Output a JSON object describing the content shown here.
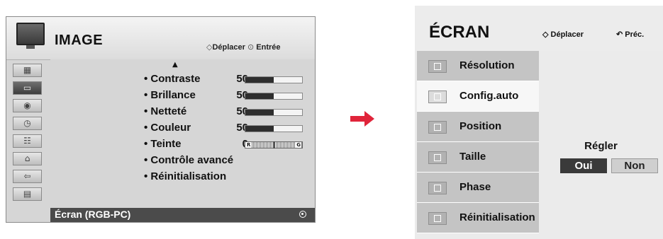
{
  "image_menu": {
    "title": "IMAGE",
    "hint_move": "Déplacer",
    "hint_enter": "Entrée",
    "sidebar_icons": [
      "picture-icon",
      "screen-icon",
      "audio-icon",
      "time-icon",
      "option-icon",
      "lock-icon",
      "input-icon",
      "usb-icon"
    ],
    "options": [
      {
        "label": "• Contraste",
        "value": "50",
        "level": 0.5
      },
      {
        "label": "• Brillance",
        "value": "50",
        "level": 0.5
      },
      {
        "label": "• Netteté",
        "value": "50",
        "level": 0.5
      },
      {
        "label": "• Couleur",
        "value": "50",
        "level": 0.5
      },
      {
        "label": "• Teinte",
        "value": "0",
        "tint_left": "R",
        "tint_right": "G"
      },
      {
        "label": "• Contrôle avancé"
      },
      {
        "label": "• Réinitialisation"
      }
    ],
    "footer": "Écran (RGB-PC)"
  },
  "ecran_menu": {
    "title": "ÉCRAN",
    "hint_move": "Déplacer",
    "hint_back": "Préc.",
    "items": [
      {
        "label": "Résolution"
      },
      {
        "label": "Config.auto",
        "active": true
      },
      {
        "label": "Position"
      },
      {
        "label": "Taille"
      },
      {
        "label": "Phase"
      },
      {
        "label": "Réinitialisation"
      }
    ],
    "panel": {
      "label": "Régler",
      "yes": "Oui",
      "no": "Non"
    }
  },
  "colors": {
    "arrow": "#e0243a",
    "highlight": "#4b4b4b"
  }
}
